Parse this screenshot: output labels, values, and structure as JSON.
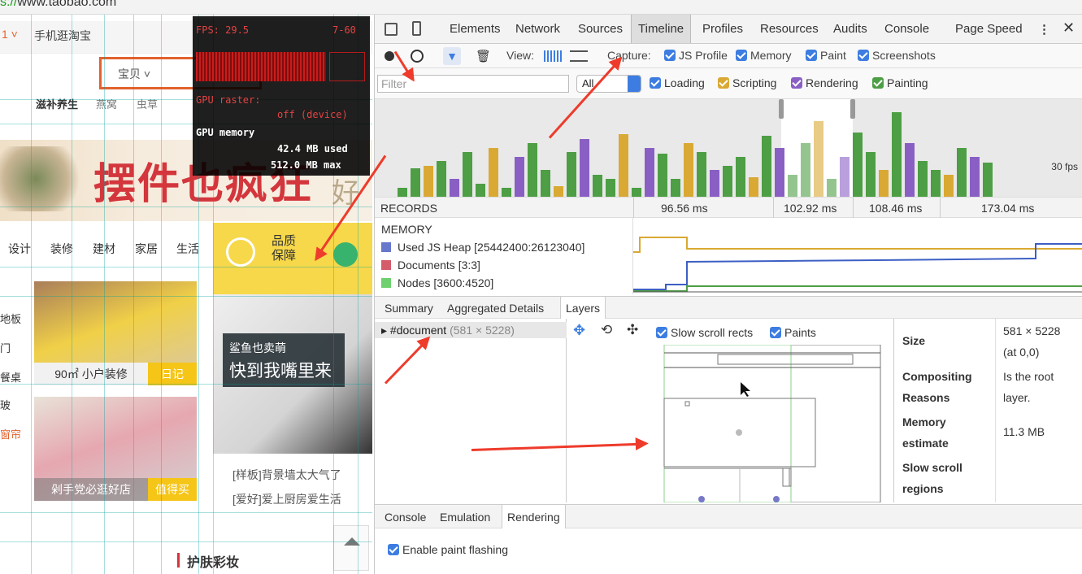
{
  "browser": {
    "url_scheme": "s://",
    "url_host": "www.taobao.com"
  },
  "page": {
    "nav": [
      "1 ˅",
      "手机逛淘宝"
    ],
    "search_dropdown": "宝贝 ˅",
    "subnav": [
      "滋补养生",
      "燕窝",
      "虫草"
    ],
    "banner_text": "摆件也疯狂",
    "banner_tail": "好",
    "categories": [
      "设计",
      "装修",
      "建材",
      "家居",
      "生活"
    ],
    "promise": [
      "品质",
      "保障"
    ],
    "cards": [
      {
        "label": "90㎡ 小户装修",
        "tag": "日记"
      },
      {
        "label": "剁手党必逛好店",
        "tag": "值得买"
      }
    ],
    "shark_small": "鲨鱼也卖萌",
    "shark_big": "快到我嘴里来",
    "links": [
      "[样板]背景墙太大气了",
      "[爱好]爱上厨房爱生活"
    ],
    "left_items": [
      "地板",
      "门",
      "餐桌",
      "玻",
      "窗帘"
    ],
    "beauty": "护肤彩妆"
  },
  "fps_meter": {
    "fps": "FPS: 29.5",
    "range": "7-60",
    "raster_label": "GPU raster:",
    "raster_val": "off (device)",
    "mem_label": "GPU memory",
    "used": "42.4 MB used",
    "max": "512.0 MB max"
  },
  "devtools": {
    "tabs": [
      "Elements",
      "Network",
      "Sources",
      "Timeline",
      "Profiles",
      "Resources",
      "Audits",
      "Console",
      "Page Speed"
    ],
    "active_tab": "Timeline",
    "view_label": "View:",
    "capture_label": "Capture:",
    "capture": [
      "JS Profile",
      "Memory",
      "Paint",
      "Screenshots"
    ],
    "filter_placeholder": "Filter",
    "filter_select": "All",
    "categories": [
      "Loading",
      "Scripting",
      "Rendering",
      "Painting"
    ],
    "fps_label": "30 fps",
    "records_label": "RECORDS",
    "timings": [
      "96.56 ms",
      "102.92 ms",
      "108.46 ms",
      "173.04 ms"
    ],
    "memory_title": "MEMORY",
    "memory_rows": [
      "Used JS Heap [25442400:26123040]",
      "Documents [3:3]",
      "Nodes [3600:4520]"
    ],
    "memory_colors": [
      "#6677cc",
      "#d45c6b",
      "#6ed06e"
    ],
    "bottom_tabs": [
      "Summary",
      "Aggregated Details",
      "Layers"
    ],
    "active_bottom_tab": "Layers",
    "layer_node": "#document",
    "layer_dims": "(581 × 5228)",
    "layer_options": [
      "Slow scroll rects",
      "Paints"
    ],
    "details": [
      {
        "k": "Size",
        "v1": "581 × 5228",
        "v2": "(at 0,0)"
      },
      {
        "k": "Compositing",
        "k2": "Reasons",
        "v1": "Is the root",
        "v2": "layer."
      },
      {
        "k": "Memory",
        "k2": "estimate",
        "v1": "11.3 MB",
        "v2": ""
      },
      {
        "k": "Slow scroll",
        "k2": "regions",
        "v1": "",
        "v2": ""
      }
    ],
    "drawer_tabs": [
      "Console",
      "Emulation",
      "Rendering"
    ],
    "active_drawer_tab": "Rendering",
    "paint_flashing": "Enable paint flashing"
  }
}
